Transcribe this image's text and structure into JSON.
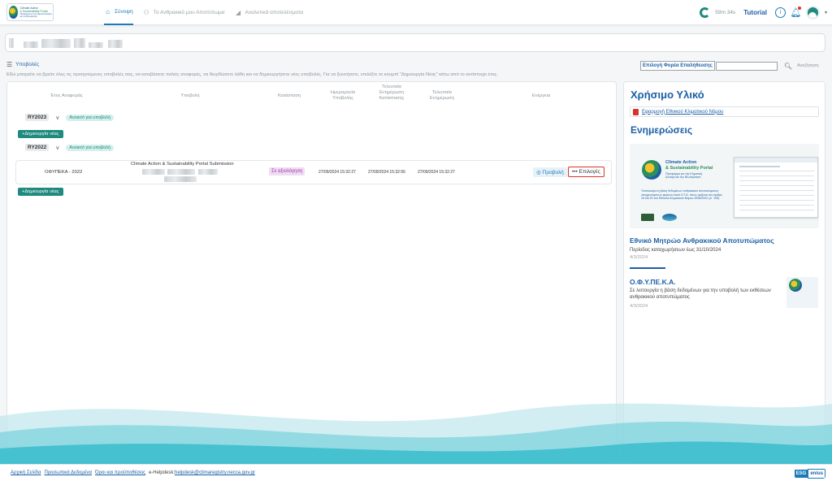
{
  "header": {
    "logo": {
      "line1": "Climate Action",
      "line2": "& Sustainability Portal",
      "line3": "Πλατφόρμα για την Κλιματική Αλλαγή και την Βιωσιμότητα"
    },
    "nav": [
      {
        "label": "Σύνοψη",
        "icon": "home-icon",
        "active": true
      },
      {
        "label": "Το Ανθρακικό μου Αποτύπωμα",
        "icon": "people-icon",
        "active": false
      },
      {
        "label": "Αναλυτικά αποτελέσματα",
        "icon": "chart-icon",
        "active": false
      }
    ],
    "timer": "59m 34s",
    "tutorial": "Tutorial",
    "colors": {
      "accent": "#1b7bb8",
      "brand": "#1b5fa5",
      "green": "#1f8a7e"
    }
  },
  "main": {
    "section_title": "Υποβολές",
    "description": "Εδώ μπορείτε να βρείτε όλες τις προηγούμενες υποβολές σας, να κατεβάσετε παλιές αναφορές, να διορθώσετε λάθη και να δημιουργήσετε νέες υποβολές. Για να ξεκινήσετε, επιλέξτε το κουμπί \"Δημιουργία Νέας\" κάτω από το αντίστοιχο έτος.",
    "filter_label": "Επιλογή Φορέα Επαλήθευσης",
    "filter_value": "",
    "search_label": "Αναζήτηση",
    "table": {
      "headers": [
        "Έτος Αναφοράς",
        "Υποβολή",
        "Κατάσταση",
        "Ημερομηνία Υποβολής",
        "Τελευταία Ενημέρωση Κατάστασης",
        "Τελευταία Ενημέρωση",
        "Ενέργεια"
      ],
      "years": [
        {
          "year": "RY2023",
          "status": "Ανοικτό για υποβολή",
          "create_label": "+Δημιουργία νέας"
        },
        {
          "year": "RY2022",
          "status": "Ανοικτό για υποβολή",
          "create_label": "+Δημιουργία νέας"
        }
      ],
      "row": {
        "year": "ΟΦΥΠΕΚΑ - 2022",
        "submission_title": "Climate Action & Sustainability Portal Submission",
        "status": "Σε αξιολόγηση",
        "submitted": "27/09/2024 15:32:27",
        "status_updated": "27/09/2024 15:32:56",
        "updated": "27/09/2024 15:32:27",
        "view_label": "Προβολή",
        "options_label": "••• Επιλογές"
      }
    }
  },
  "side": {
    "useful_title": "Χρήσιμο Υλικό",
    "doc_link": "Εφαρμογή Εθνικού Κλιματικού Νόμου",
    "news_title": "Ενημερώσεις",
    "banner": {
      "title1": "Climate Action",
      "title2": "& Sustainability Portal",
      "subtitle": "Πλατφόρμα για την Κλιματική Αλλαγή και την Βιωσιμότητα",
      "note": "Υλοποιούμενη βάση δεδομένων ανθρακικού αποτυπώματος υποχρεούμενων φορέων κατά Ο.Τ.Α. όπως ορίζεται στο άρθρο 15 και 20 του Εθνικού Κλιματικού Νόμου 4936/2022 (Α΄ 105)"
    },
    "news": [
      {
        "title": "Εθνικό Μητρώο Ανθρακικού Αποτυπώματος",
        "text": "Περίοδος καταχωρήσεων έως 31/10/2024",
        "date": "4/3/2024"
      },
      {
        "title": "Ο.Φ.Υ.ΠΕ.Κ.Α.",
        "text": "Σε λειτουργία η βάση δεδομένων για την υποβολή των εκθέσεων ανθρακικού αποτυπώματος",
        "date": "4/3/2024"
      }
    ]
  },
  "footer": {
    "links": [
      "Αρχική Σελίδα",
      "Προσωπικά Δεδομένα",
      "Όροι και προϋποθέσεις"
    ],
    "helpdesk_label": "e-Helpdesk:",
    "helpdesk_email": "helpdesk@climaregistry.necca.gov.gr",
    "logo_a": "ESG",
    "logo_b": "enius"
  }
}
